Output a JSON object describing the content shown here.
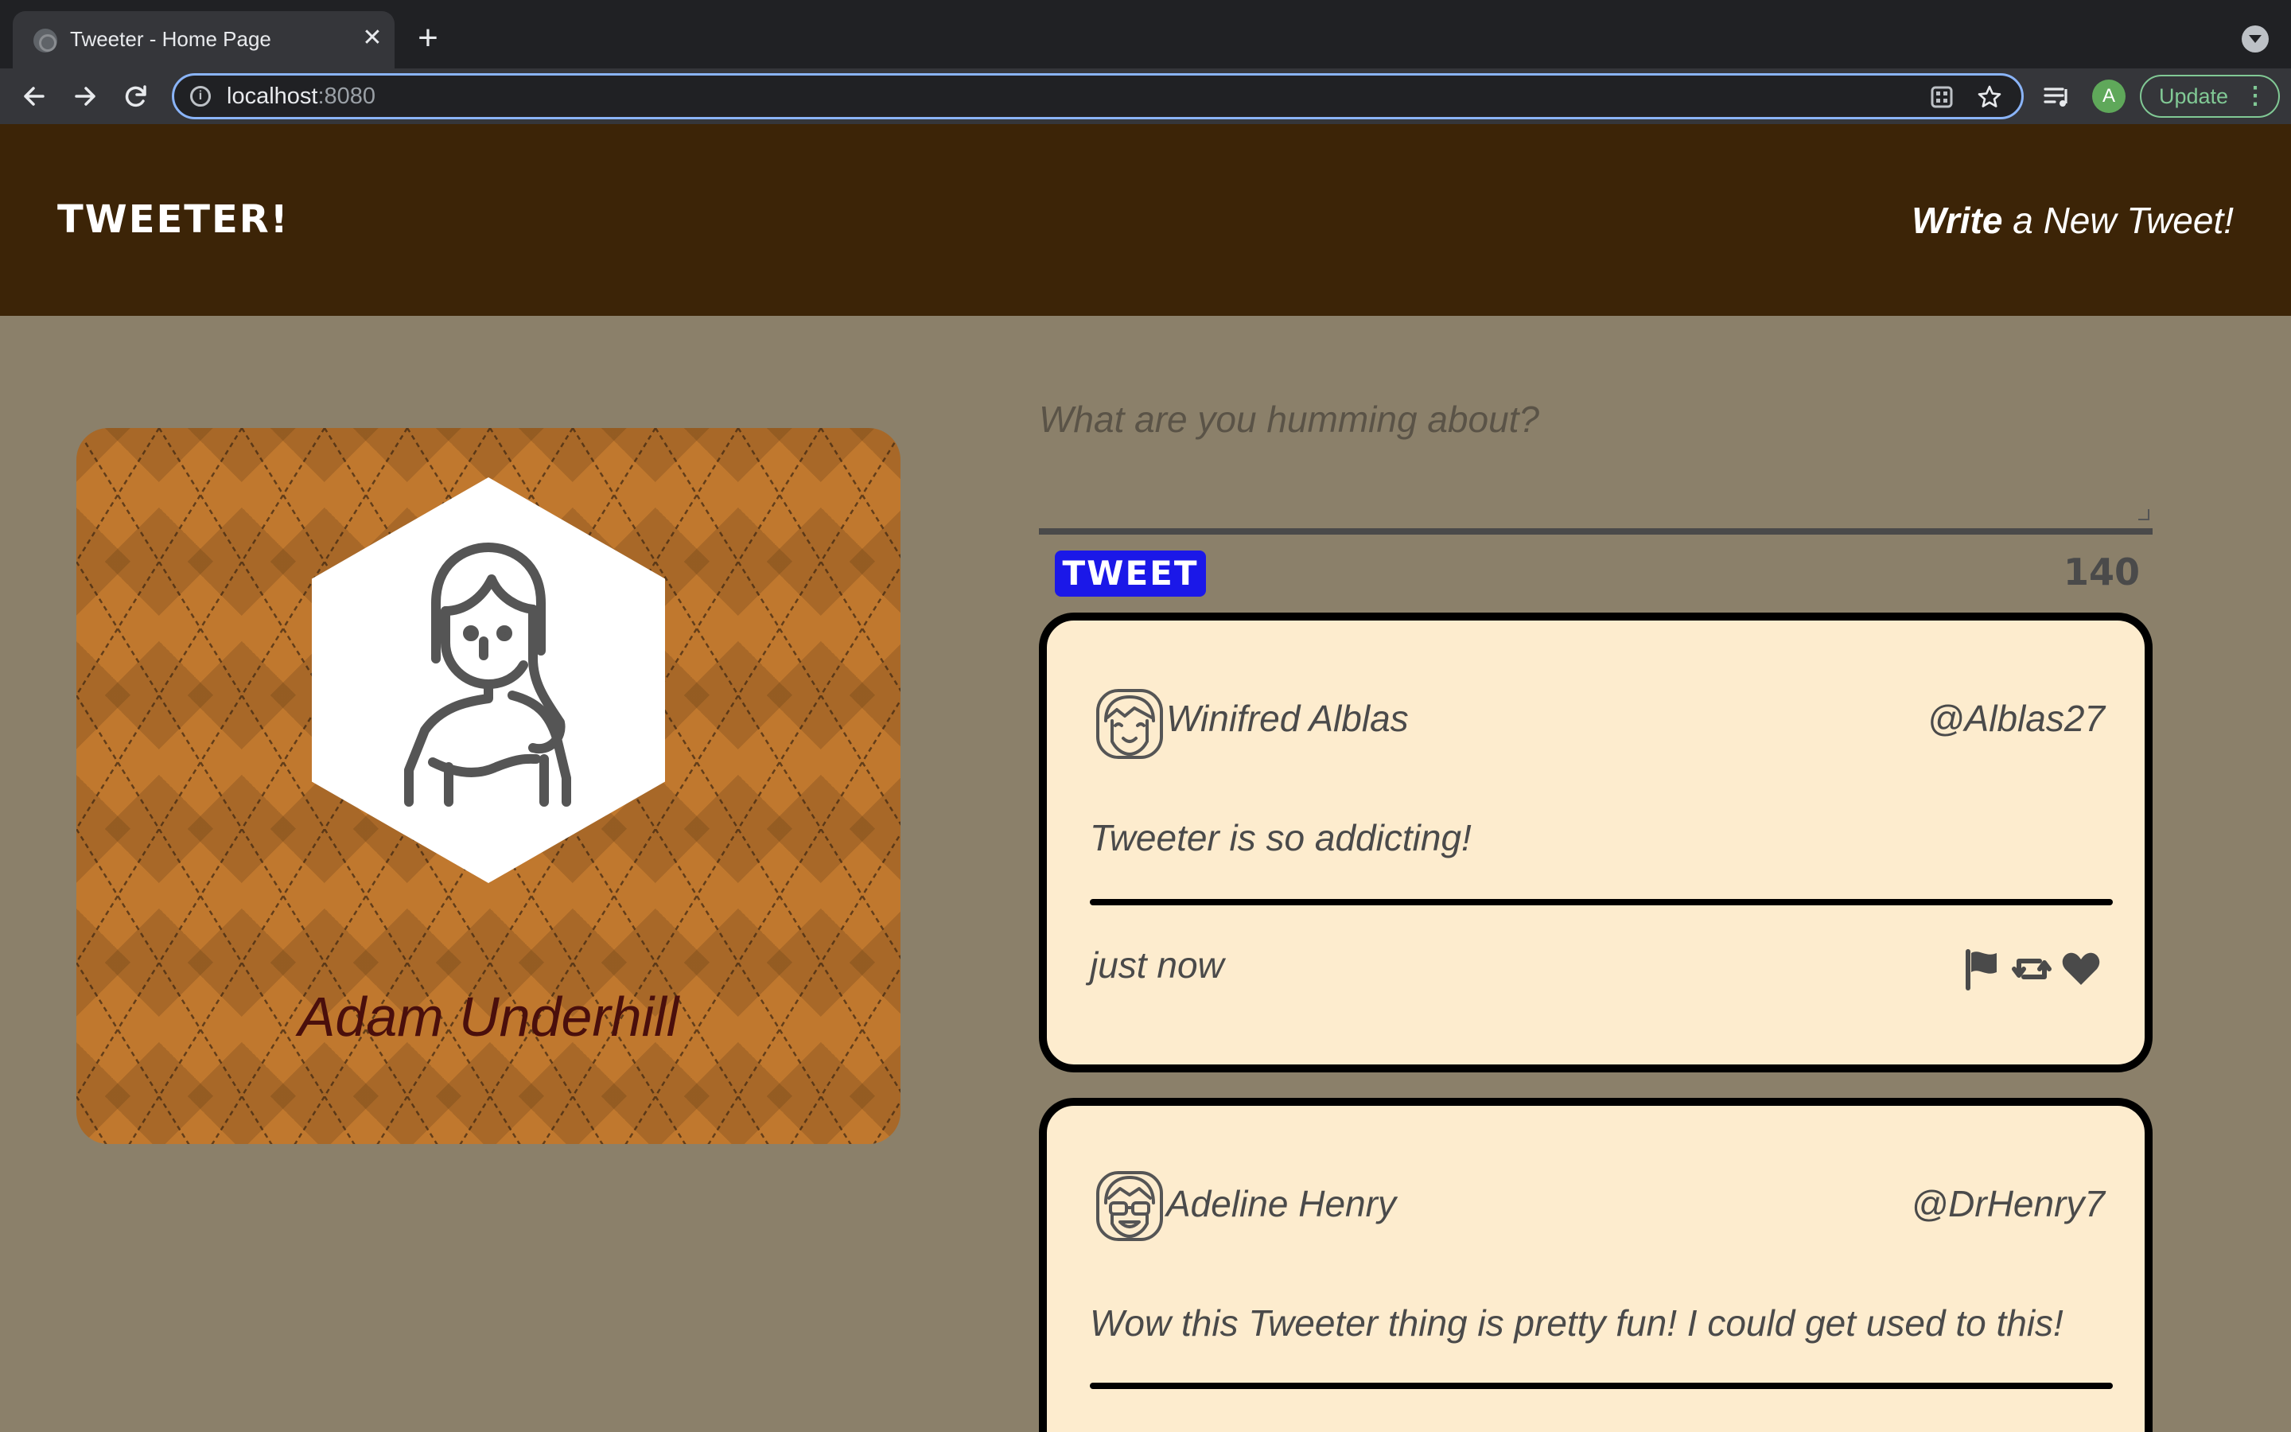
{
  "browser": {
    "tab_title": "Tweeter - Home Page",
    "tab_close": "✕",
    "new_tab": "+",
    "url_host": "localhost",
    "url_port": ":8080",
    "profile_initial": "A",
    "update_label": "Update",
    "menu_dots": "⋮",
    "info_glyph": "i"
  },
  "header": {
    "logo": "TWEETER!",
    "write_bold": "Write",
    "write_rest": " a New Tweet!"
  },
  "profile": {
    "name": "Adam Underhill"
  },
  "compose": {
    "placeholder": "What are you humming about?",
    "button_label": "TWEET",
    "counter": "140"
  },
  "tweets": [
    {
      "name": "Winifred Alblas",
      "handle": "@Alblas27",
      "content": "Tweeter is so addicting!",
      "time": "just now"
    },
    {
      "name": "Adeline Henry",
      "handle": "@DrHenry7",
      "content": "Wow this Tweeter thing is pretty fun! I could get used to this!"
    }
  ],
  "colors": {
    "header_bg": "#3c2407",
    "page_bg": "#8b806a",
    "card_bg": "#fdecce",
    "tweet_button": "#1b18e8",
    "profile_name": "#4a0f0c",
    "argyle": "#c0782e"
  },
  "icons": {
    "nav": [
      "back-arrow-icon",
      "forward-arrow-icon",
      "reload-icon"
    ],
    "omnibox": [
      "info-icon",
      "qr-code-icon",
      "bookmark-star-icon"
    ],
    "toolbar": [
      "reading-list-icon"
    ],
    "tweet_actions": [
      "flag-icon",
      "retweet-icon",
      "heart-icon"
    ]
  }
}
